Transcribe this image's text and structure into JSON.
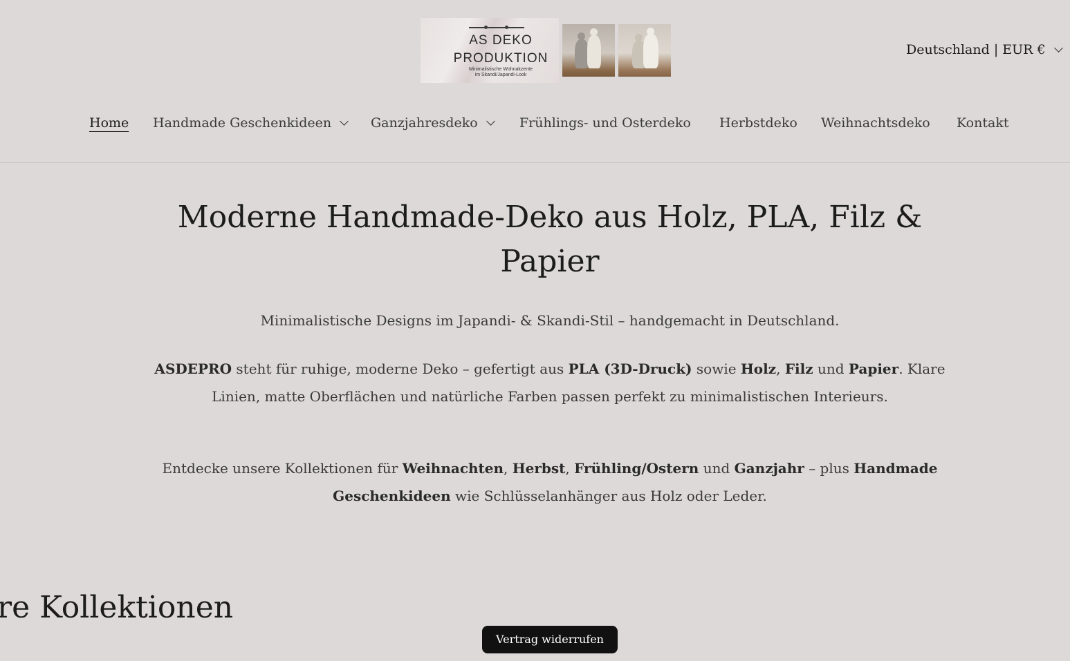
{
  "logo": {
    "line1": "AS DEKO",
    "line2": "PRODUKTION",
    "tagline1": "Minimalistische Wohnakzente",
    "tagline2": "im Skandi/Japandi-Look"
  },
  "locale": {
    "label": "Deutschland | EUR €"
  },
  "nav": {
    "items": [
      {
        "label": "Home",
        "active": true
      },
      {
        "label": "Handmade Geschenkideen",
        "dropdown": true
      },
      {
        "label": "Ganzjahresdeko",
        "dropdown": true
      },
      {
        "label": "Frühlings- und Osterdeko"
      },
      {
        "label": "Herbstdeko"
      },
      {
        "label": "Weihnachtsdeko"
      },
      {
        "label": "Kontakt"
      }
    ]
  },
  "hero": {
    "title": "Moderne Handmade-Deko aus Holz, PLA, Filz & Papier",
    "subtitle": "Minimalistische Designs im Japandi- & Skandi-Stil – handgemacht in Deutschland.",
    "intro": {
      "brand": "ASDEPRO",
      "t1": " steht für ruhige, moderne Deko – gefertigt aus ",
      "m1": "PLA (3D-Druck)",
      "t2": " sowie ",
      "m2": "Holz",
      "t3": ", ",
      "m3": "Filz",
      "t4": " und ",
      "m4": "Papier",
      "t5": ". Klare Linien, matte Oberflächen und natürliche Farben passen perfekt zu minimalistischen Interieurs."
    },
    "collections": {
      "t1": "Entdecke unsere Kollektionen für ",
      "c1": "Weihnachten",
      "t2": ", ",
      "c2": "Herbst",
      "t3": ", ",
      "c3": "Frühling/Ostern",
      "t4": " und ",
      "c4": "Ganzjahr",
      "t5": " – plus ",
      "c5": "Handmade Geschenkideen",
      "t6": " wie Schlüsselanhänger aus Holz oder Leder."
    }
  },
  "section": {
    "title": "ere Kollektionen"
  },
  "revoke_button": {
    "label": "Vertrag widerrufen"
  }
}
